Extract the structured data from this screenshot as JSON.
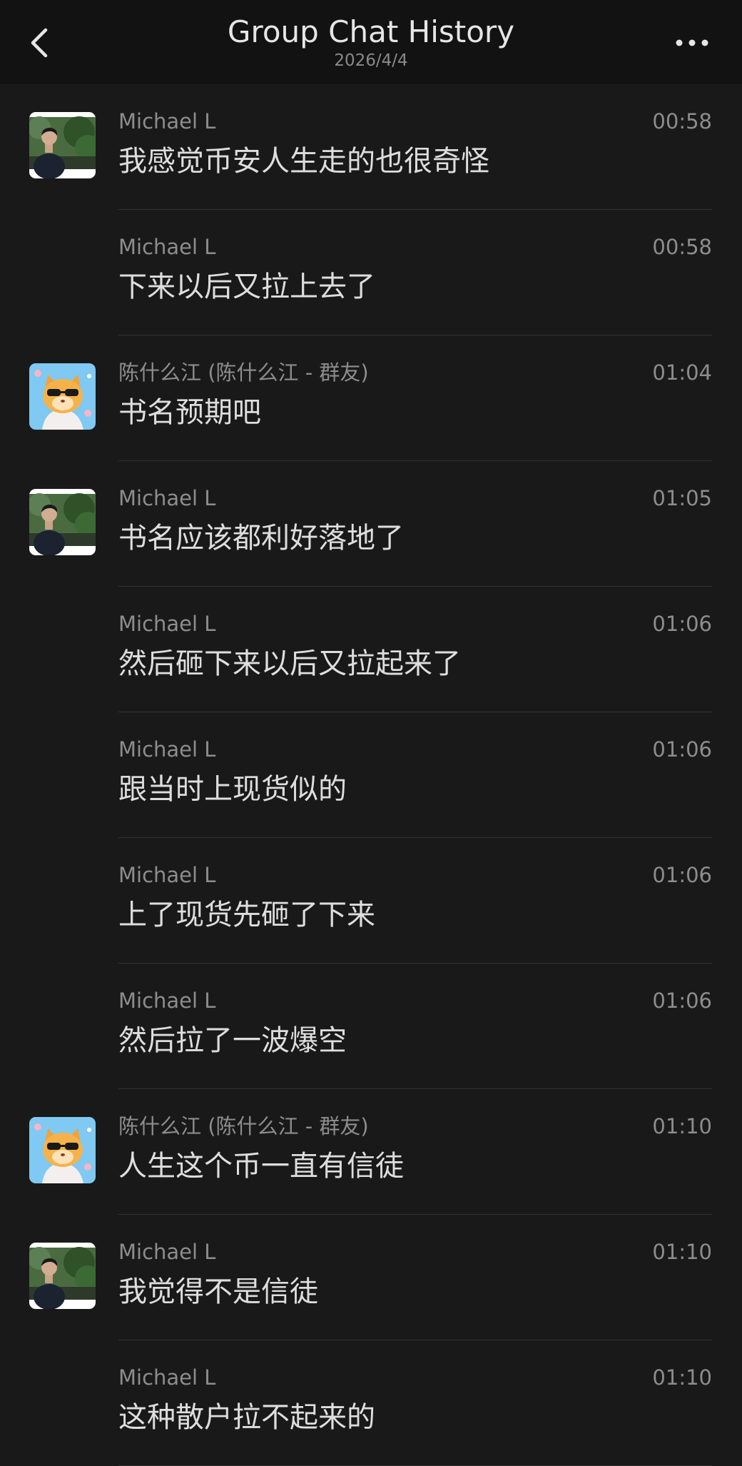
{
  "header": {
    "title": "Group Chat History",
    "date": "2026/4/4",
    "back_icon": "chevron-left-icon",
    "more_icon": "more-horizontal-icon"
  },
  "colors": {
    "background": "#191919",
    "header_background": "#121212",
    "divider": "#333333",
    "meta_text": "#8d8d8d",
    "message_text": "#dedede"
  },
  "messages": [
    {
      "sender": "Michael L",
      "time": "00:58",
      "text": "我感觉币安人生走的也很奇怪",
      "avatar": "michael"
    },
    {
      "sender": "Michael L",
      "time": "00:58",
      "text": "下来以后又拉上去了",
      "avatar": ""
    },
    {
      "sender": "陈什么江 (陈什么江 - 群友)",
      "time": "01:04",
      "text": "书名预期吧",
      "avatar": "cat"
    },
    {
      "sender": "Michael L",
      "time": "01:05",
      "text": "书名应该都利好落地了",
      "avatar": "michael"
    },
    {
      "sender": "Michael L",
      "time": "01:06",
      "text": "然后砸下来以后又拉起来了",
      "avatar": ""
    },
    {
      "sender": "Michael L",
      "time": "01:06",
      "text": "跟当时上现货似的",
      "avatar": ""
    },
    {
      "sender": "Michael L",
      "time": "01:06",
      "text": "上了现货先砸了下来",
      "avatar": ""
    },
    {
      "sender": "Michael L",
      "time": "01:06",
      "text": "然后拉了一波爆空",
      "avatar": ""
    },
    {
      "sender": "陈什么江 (陈什么江 - 群友)",
      "time": "01:10",
      "text": "人生这个币一直有信徒",
      "avatar": "cat"
    },
    {
      "sender": "Michael L",
      "time": "01:10",
      "text": "我觉得不是信徒",
      "avatar": "michael"
    },
    {
      "sender": "Michael L",
      "time": "01:10",
      "text": "这种散户拉不起来的",
      "avatar": ""
    }
  ]
}
